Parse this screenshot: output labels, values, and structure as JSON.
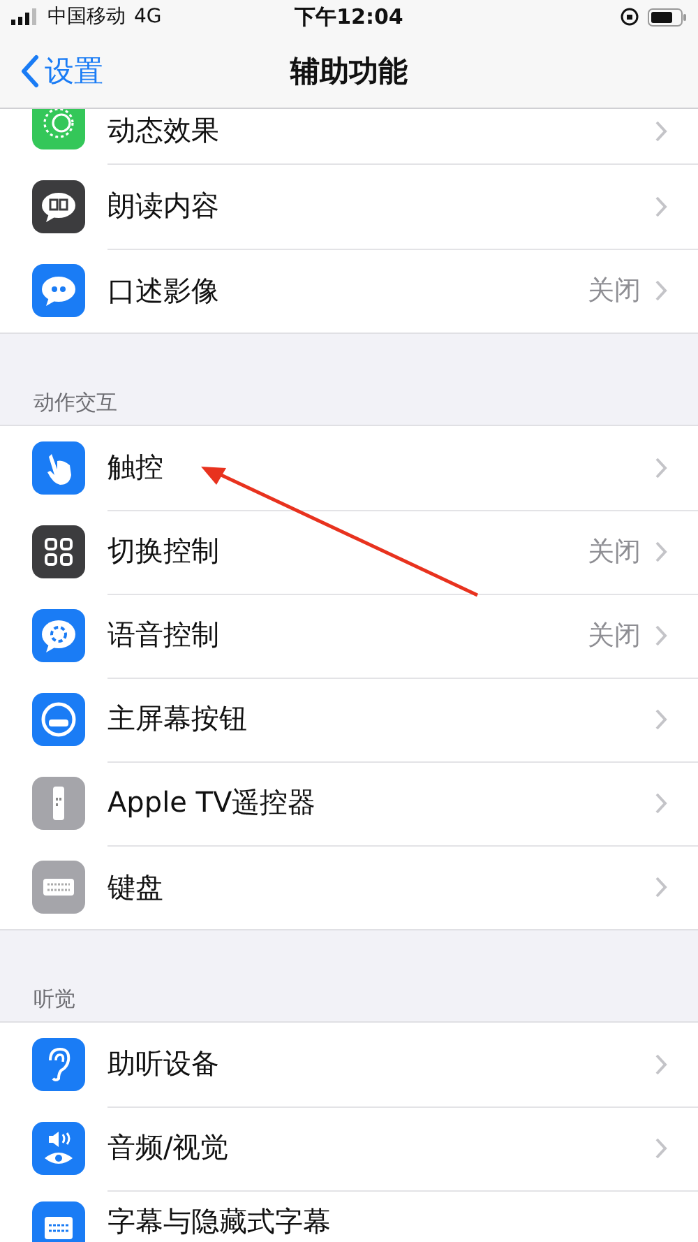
{
  "status_bar": {
    "carrier": "中国移动",
    "network": "4G",
    "time": "下午12:04"
  },
  "nav": {
    "back": "设置",
    "title": "辅助功能"
  },
  "sections": [
    {
      "rows": [
        {
          "label": "动态效果"
        },
        {
          "label": "朗读内容"
        },
        {
          "label": "口述影像",
          "value": "关闭"
        }
      ]
    },
    {
      "header": "动作交互",
      "rows": [
        {
          "label": "触控"
        },
        {
          "label": "切换控制",
          "value": "关闭"
        },
        {
          "label": "语音控制",
          "value": "关闭"
        },
        {
          "label": "主屏幕按钮"
        },
        {
          "label": "Apple TV遥控器"
        },
        {
          "label": "键盘"
        }
      ]
    },
    {
      "header": "听觉",
      "rows": [
        {
          "label": "助听设备"
        },
        {
          "label": "音频/视觉"
        },
        {
          "label": "字幕与隐藏式字幕"
        }
      ]
    }
  ]
}
